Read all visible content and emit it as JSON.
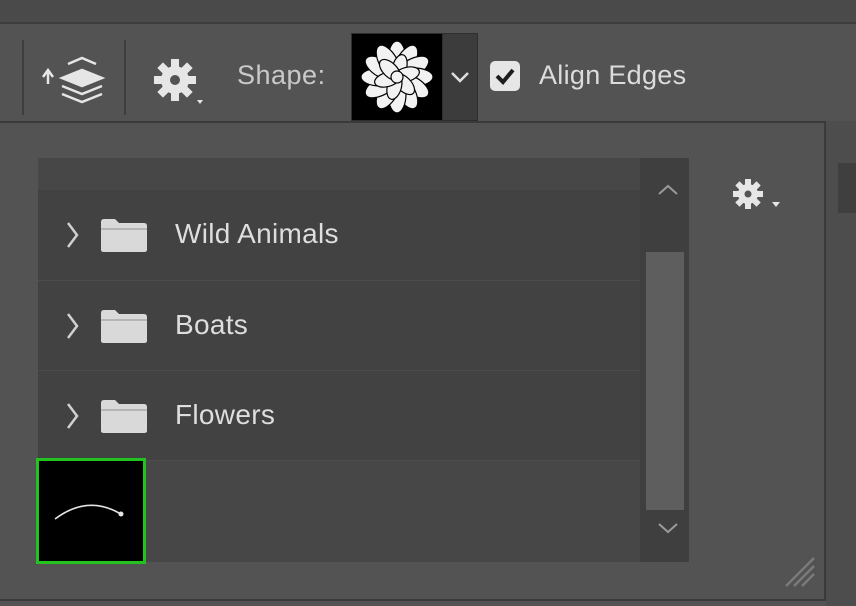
{
  "toolbar": {
    "shape_label": "Shape:",
    "align_edges_label": "Align Edges",
    "align_edges_checked": true,
    "icons": {
      "path_arrangement": "layers-stack-icon",
      "settings": "gear-icon",
      "shape_preview": "flower-shape-icon",
      "dropdown": "chevron-down-icon"
    }
  },
  "picker": {
    "folders": [
      {
        "label": "Wild Animals"
      },
      {
        "label": "Boats"
      },
      {
        "label": "Flowers"
      }
    ],
    "icons": {
      "settings": "gear-icon",
      "scroll_up": "chevron-up-icon",
      "scroll_down": "chevron-down-icon",
      "resize": "resize-grip-icon",
      "selected_thumb": "arc-shape-icon"
    }
  },
  "colors": {
    "selection_outline": "#22c31f",
    "panel_bg": "#535353",
    "list_bg": "#424242"
  }
}
